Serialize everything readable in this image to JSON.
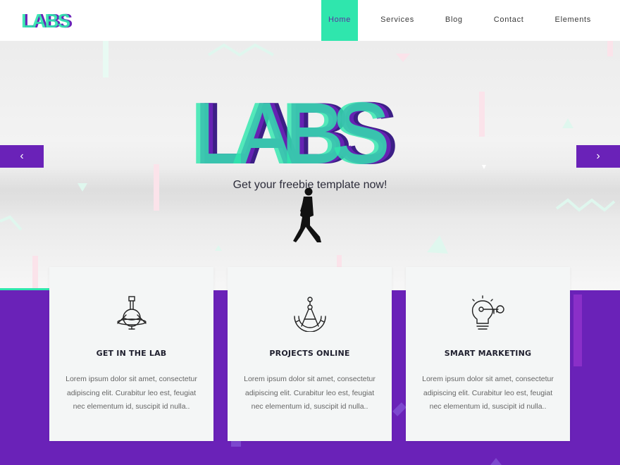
{
  "header": {
    "logo_text": "LABS",
    "nav": [
      {
        "label": "Home",
        "active": true
      },
      {
        "label": "Services",
        "active": false
      },
      {
        "label": "Blog",
        "active": false
      },
      {
        "label": "Contact",
        "active": false
      },
      {
        "label": "Elements",
        "active": false
      }
    ]
  },
  "hero": {
    "title": "LABS",
    "tagline": "Get your freebie template now!",
    "prev_icon": "chevron-left-icon",
    "next_icon": "chevron-right-icon"
  },
  "features": [
    {
      "icon": "flask-icon",
      "title": "GET IN THE LAB",
      "text": "Lorem ipsum dolor sit amet, consectetur adipiscing elit. Curabitur leo est, feugiat nec elementum id, suscipit id nulla.."
    },
    {
      "icon": "compass-icon",
      "title": "PROJECTS ONLINE",
      "text": "Lorem ipsum dolor sit amet, consectetur adipiscing elit. Curabitur leo est, feugiat nec elementum id, suscipit id nulla.."
    },
    {
      "icon": "lightbulb-key-icon",
      "title": "SMART MARKETING",
      "text": "Lorem ipsum dolor sit amet, consectetur adipiscing elit. Curabitur leo est, feugiat nec elementum id, suscipit id nulla.."
    }
  ],
  "colors": {
    "accent_green": "#2fe6ad",
    "accent_purple": "#6a22b8",
    "dark_purple": "#3c1f86"
  }
}
